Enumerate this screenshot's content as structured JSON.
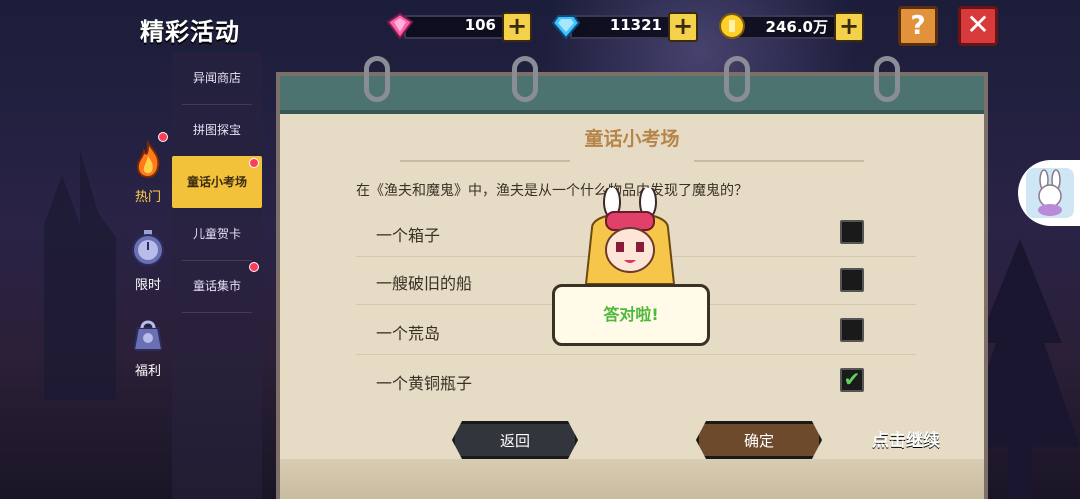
{
  "header": {
    "title": "精彩活动",
    "currencies": [
      {
        "icon": "pink-gem-icon",
        "value": "106"
      },
      {
        "icon": "blue-diamond-icon",
        "value": "11321"
      },
      {
        "icon": "gold-coin-icon",
        "value": "246.0万"
      }
    ],
    "help_label": "?",
    "close_label": "✕"
  },
  "categories": [
    {
      "label": "热门",
      "icon": "fire-icon",
      "active": true
    },
    {
      "label": "限时",
      "icon": "stopwatch-icon",
      "active": false
    },
    {
      "label": "福利",
      "icon": "gift-bag-icon",
      "active": false
    }
  ],
  "submenu": [
    {
      "label": "异闻商店"
    },
    {
      "label": "拼图探宝"
    },
    {
      "label": "童话小考场",
      "active": true
    },
    {
      "label": "儿童贺卡"
    },
    {
      "label": "童话集市"
    }
  ],
  "quiz": {
    "title": "童话小考场",
    "question": "在《渔夫和魔鬼》中，渔夫是从一个什么物品内发现了魔鬼的？",
    "options": [
      {
        "label": "一个箱子",
        "checked": false
      },
      {
        "label": "一艘破旧的船",
        "checked": false
      },
      {
        "label": "一个荒岛",
        "checked": false
      },
      {
        "label": "一个黄铜瓶子",
        "checked": true
      }
    ],
    "back_label": "返回",
    "confirm_label": "确定"
  },
  "feedback": {
    "bubble_text": "答对啦!",
    "continue_text": "点击继续"
  },
  "colors": {
    "accent": "#f2c23a",
    "panel": "#e6dcc6",
    "header_teal": "#4c7370",
    "correct_green": "#4fb83c"
  }
}
